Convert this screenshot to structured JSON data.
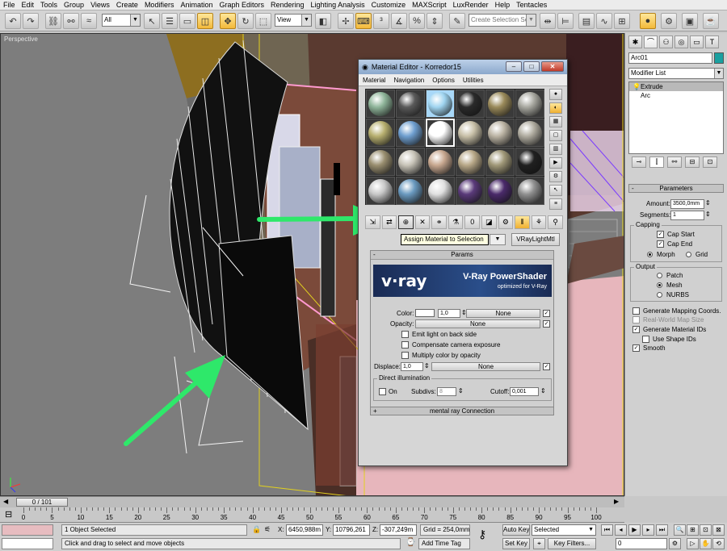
{
  "menu": [
    "File",
    "Edit",
    "Tools",
    "Group",
    "Views",
    "Create",
    "Modifiers",
    "Animation",
    "Graph Editors",
    "Rendering",
    "Lighting Analysis",
    "Customize",
    "MAXScript",
    "LuxRender",
    "Help",
    "Tentacles"
  ],
  "toolbar": {
    "selection_filter": "All",
    "ref_coord": "View",
    "named_selection_placeholder": "Create Selection Set"
  },
  "viewport": {
    "label": "Perspective"
  },
  "material_editor": {
    "title": "Material Editor - Korredor15",
    "menu": [
      "Material",
      "Navigation",
      "Options",
      "Utilities"
    ],
    "tooltip": "Assign Material to Selection",
    "material_type": "VRayLightMtl",
    "params_rollout": "Params",
    "banner_logo": "v·ray",
    "banner_title": "V-Ray PowerShader",
    "banner_subtitle": "optimized for V-Ray",
    "color_label": "Color:",
    "color_value": "1,0",
    "color_map": "None",
    "opacity_label": "Opacity:",
    "opacity_map": "None",
    "emit_back": "Emit light on back side",
    "compensate": "Compensate camera exposure",
    "multiply": "Multiply color by opacity",
    "displace_label": "Displace:",
    "displace_value": "1,0",
    "displace_map": "None",
    "direct_group": "Direct illumination",
    "on_label": "On",
    "subdivs_label": "Subdivs:",
    "subdivs_value": "8",
    "cutoff_label": "Cutoff:",
    "cutoff_value": "0,001",
    "mental_ray": "mental ray Connection",
    "sphere_colors": [
      [
        "#8fb59a",
        "#5a5a5a",
        "#9fd4f0",
        "#2a2a2a",
        "#9a8a5a",
        "#a8a8a0"
      ],
      [
        "#b8b070",
        "#6f9fd0",
        "#ffffff",
        "#c8c0a8",
        "#bcb4a4",
        "#b0aca0"
      ],
      [
        "#9a8f70",
        "#c8c4b8",
        "#c8a890",
        "#b8a888",
        "#a09878",
        "#202020"
      ],
      [
        "#c8c8c8",
        "#6a9ac0",
        "#e0e0e0",
        "#5a3a7a",
        "#4a2a6a",
        "#909090"
      ]
    ]
  },
  "command_panel": {
    "object_name": "Arc01",
    "modifier_list": "Modifier List",
    "stack": [
      "Extrude",
      "Arc"
    ],
    "parameters_rollout": "Parameters",
    "amount_label": "Amount:",
    "amount_value": "3500,0mm",
    "segments_label": "Segments:",
    "segments_value": "1",
    "capping_group": "Capping",
    "cap_start": "Cap Start",
    "cap_end": "Cap End",
    "morph": "Morph",
    "grid": "Grid",
    "output_group": "Output",
    "patch": "Patch",
    "mesh": "Mesh",
    "nurbs": "NURBS",
    "gen_mapping": "Generate Mapping Coords.",
    "real_world": "Real-World Map Size",
    "gen_matids": "Generate Material IDs",
    "use_shape_ids": "Use Shape IDs",
    "smooth": "Smooth"
  },
  "timeline": {
    "slider": "0 / 101",
    "ticks": [
      "0",
      "5",
      "10",
      "15",
      "20",
      "25",
      "30",
      "35",
      "40",
      "45",
      "50",
      "55",
      "60",
      "65",
      "70",
      "75",
      "80",
      "85",
      "90",
      "95",
      "100"
    ]
  },
  "status": {
    "selected": "1 Object Selected",
    "prompt": "Click and drag to select and move objects",
    "x_label": "X:",
    "x_value": "6450,988m",
    "y_label": "Y:",
    "y_value": "10796,261",
    "z_label": "Z:",
    "z_value": "-307,249m",
    "grid": "Grid = 254,0mm",
    "add_time_tag": "Add Time Tag",
    "auto_key": "Auto Key",
    "selected_dropdown": "Selected",
    "set_key": "Set Key",
    "key_filters": "Key Filters...",
    "frame": "0"
  },
  "colors": {
    "accent_active": "#f3b93a",
    "arrow_green": "#2ee86a",
    "viewport_bg": "#7a7a7a"
  }
}
